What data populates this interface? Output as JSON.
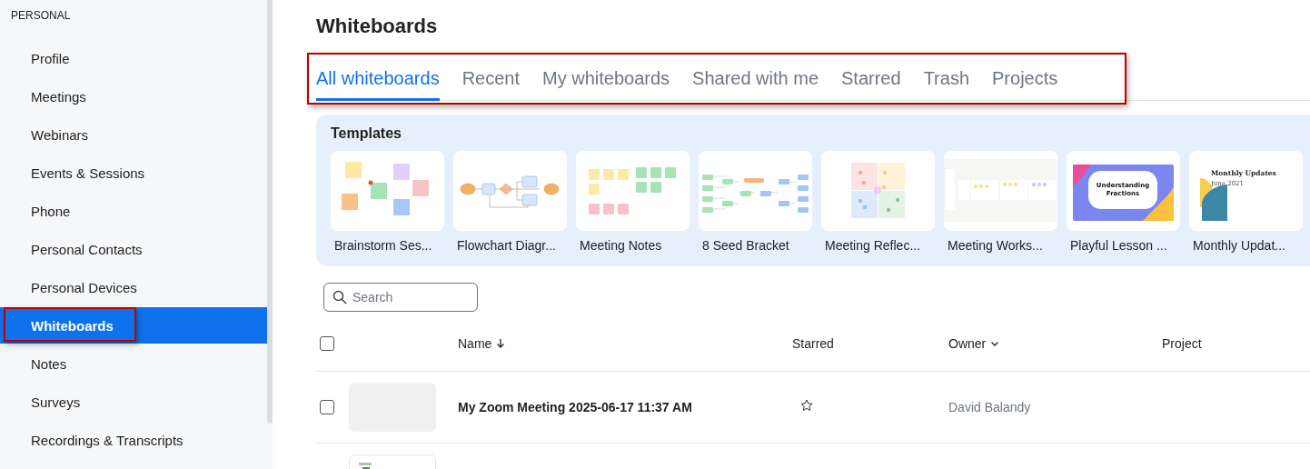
{
  "sidebar": {
    "section": "PERSONAL",
    "items": [
      {
        "label": "Profile",
        "selected": false,
        "highlighted": false
      },
      {
        "label": "Meetings",
        "selected": false,
        "highlighted": false
      },
      {
        "label": "Webinars",
        "selected": false,
        "highlighted": false
      },
      {
        "label": "Events & Sessions",
        "selected": false,
        "highlighted": false
      },
      {
        "label": "Phone",
        "selected": false,
        "highlighted": false
      },
      {
        "label": "Personal Contacts",
        "selected": false,
        "highlighted": false
      },
      {
        "label": "Personal Devices",
        "selected": false,
        "highlighted": false
      },
      {
        "label": "Whiteboards",
        "selected": true,
        "highlighted": true
      },
      {
        "label": "Notes",
        "selected": false,
        "highlighted": false
      },
      {
        "label": "Surveys",
        "selected": false,
        "highlighted": false
      },
      {
        "label": "Recordings & Transcripts",
        "selected": false,
        "highlighted": false
      }
    ]
  },
  "page": {
    "title": "Whiteboards"
  },
  "tabs": {
    "highlighted": true,
    "items": [
      {
        "label": "All whiteboards",
        "selected": true
      },
      {
        "label": "Recent",
        "selected": false
      },
      {
        "label": "My whiteboards",
        "selected": false
      },
      {
        "label": "Shared with me",
        "selected": false
      },
      {
        "label": "Starred",
        "selected": false
      },
      {
        "label": "Trash",
        "selected": false
      },
      {
        "label": "Projects",
        "selected": false
      }
    ]
  },
  "templates": {
    "title": "Templates",
    "items": [
      {
        "name": "Brainstorm Ses...",
        "kind": "brainstorm"
      },
      {
        "name": "Flowchart Diagr...",
        "kind": "flowchart"
      },
      {
        "name": "Meeting Notes",
        "kind": "notes"
      },
      {
        "name": "8 Seed Bracket",
        "kind": "bracket"
      },
      {
        "name": "Meeting Reflec...",
        "kind": "quadrants"
      },
      {
        "name": "Meeting Works...",
        "kind": "workspace"
      },
      {
        "name": "Playful Lesson ...",
        "kind": "lesson",
        "heading": "Understanding Fractions"
      },
      {
        "name": "Monthly Updat...",
        "kind": "report",
        "heading": "Monthly Updates",
        "subheading": "June 2021"
      }
    ]
  },
  "search": {
    "placeholder": "Search"
  },
  "table": {
    "select_all": {
      "checked": false
    },
    "columns": [
      {
        "label": "Name",
        "kind": "sorted"
      },
      {
        "label": "Starred",
        "kind": "plain"
      },
      {
        "label": "Owner",
        "kind": "menu"
      },
      {
        "label": "Project",
        "kind": "plain"
      }
    ],
    "rows": [
      {
        "kind": "full",
        "checked": false,
        "name": "My Zoom Meeting 2025-06-17 11:37 AM",
        "starred": false,
        "owner": "David Balandy"
      },
      {
        "kind": "partial"
      }
    ]
  }
}
